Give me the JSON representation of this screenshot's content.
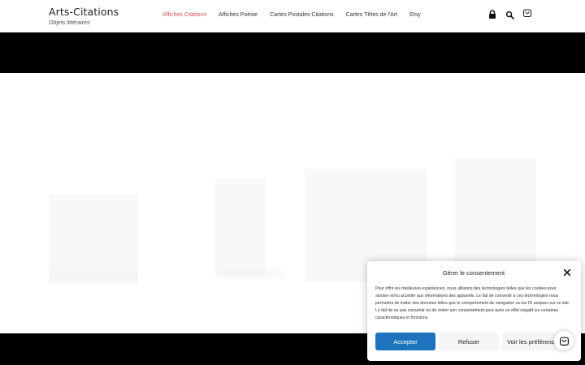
{
  "brand": {
    "title": "Arts-Citations",
    "tagline": "Objets littéraires"
  },
  "nav": {
    "items": [
      {
        "label": "Affiches Citations",
        "active": true
      },
      {
        "label": "Affiches Poésie"
      },
      {
        "label": "Cartes Postales Citations"
      },
      {
        "label": "Cartes Têtes de l'Art"
      },
      {
        "label": "Etsy"
      }
    ]
  },
  "header_icons": [
    "lock-icon",
    "search-icon",
    "shopping-bag-icon"
  ],
  "consent": {
    "title": "Gérer le consentement",
    "text": "Pour offrir les meilleures expériences, nous utilisons des technologies telles que les cookies pour stocker et/ou accéder aux informations des appareils. Le fait de consentir à ces technologies nous permettra de traiter des données telles que le comportement de navigation ou les ID uniques sur ce site. Le fait de ne pas consentir ou de retirer son consentement peut avoir un effet négatif sur certaines caractéristiques et fonctions.",
    "accept_label": "Accepter",
    "refuse_label": "Refuser",
    "prefs_label": "Voir les préférences"
  },
  "colors": {
    "accent": "#d9534f",
    "accept": "#1e73be",
    "dark": "#000000"
  }
}
